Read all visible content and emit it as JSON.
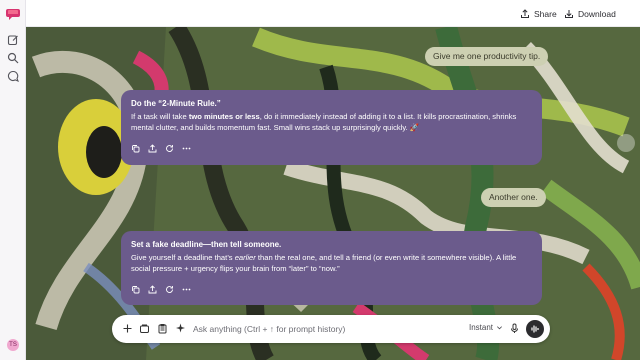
{
  "topbar": {
    "share_label": "Share",
    "download_label": "Download"
  },
  "rail": {
    "avatar_initials": "TS"
  },
  "messages": {
    "user1": "Give me one productivity tip.",
    "ai1": {
      "title": "Do the “2-Minute Rule.”",
      "pre": "If a task will take ",
      "bold": "two minutes or less",
      "post": ", do it immediately instead of adding it to a list. It kills procrastination, shrinks mental clutter, and builds momentum fast. Small wins stack up surprisingly quickly. 🚀"
    },
    "user2": "Another one.",
    "ai2": {
      "title": "Set a fake deadline—then tell someone.",
      "pre": "Give yourself a deadline that’s ",
      "em": "earlier",
      "post": " than the real one, and tell a friend (or even write it somewhere visible). A little social pressure + urgency flips your brain from “later” to “now.”"
    }
  },
  "composer": {
    "placeholder": "Ask anything (Ctrl + ↑ for prompt history)",
    "model": "Instant"
  },
  "icons": {
    "rail": [
      "logo-icon",
      "edit-icon",
      "search-icon",
      "chat-icon"
    ],
    "message_actions": [
      "copy-icon",
      "share-icon",
      "regenerate-icon",
      "more-icon"
    ],
    "composer": [
      "plus-icon",
      "attach-icon",
      "clipboard-icon",
      "sparkle-icon",
      "mic-icon",
      "voice-icon"
    ]
  },
  "colors": {
    "accent": "#6b5b8c",
    "user_bubble": "#cdd0b2",
    "rail_bg": "#f7f6f8"
  }
}
